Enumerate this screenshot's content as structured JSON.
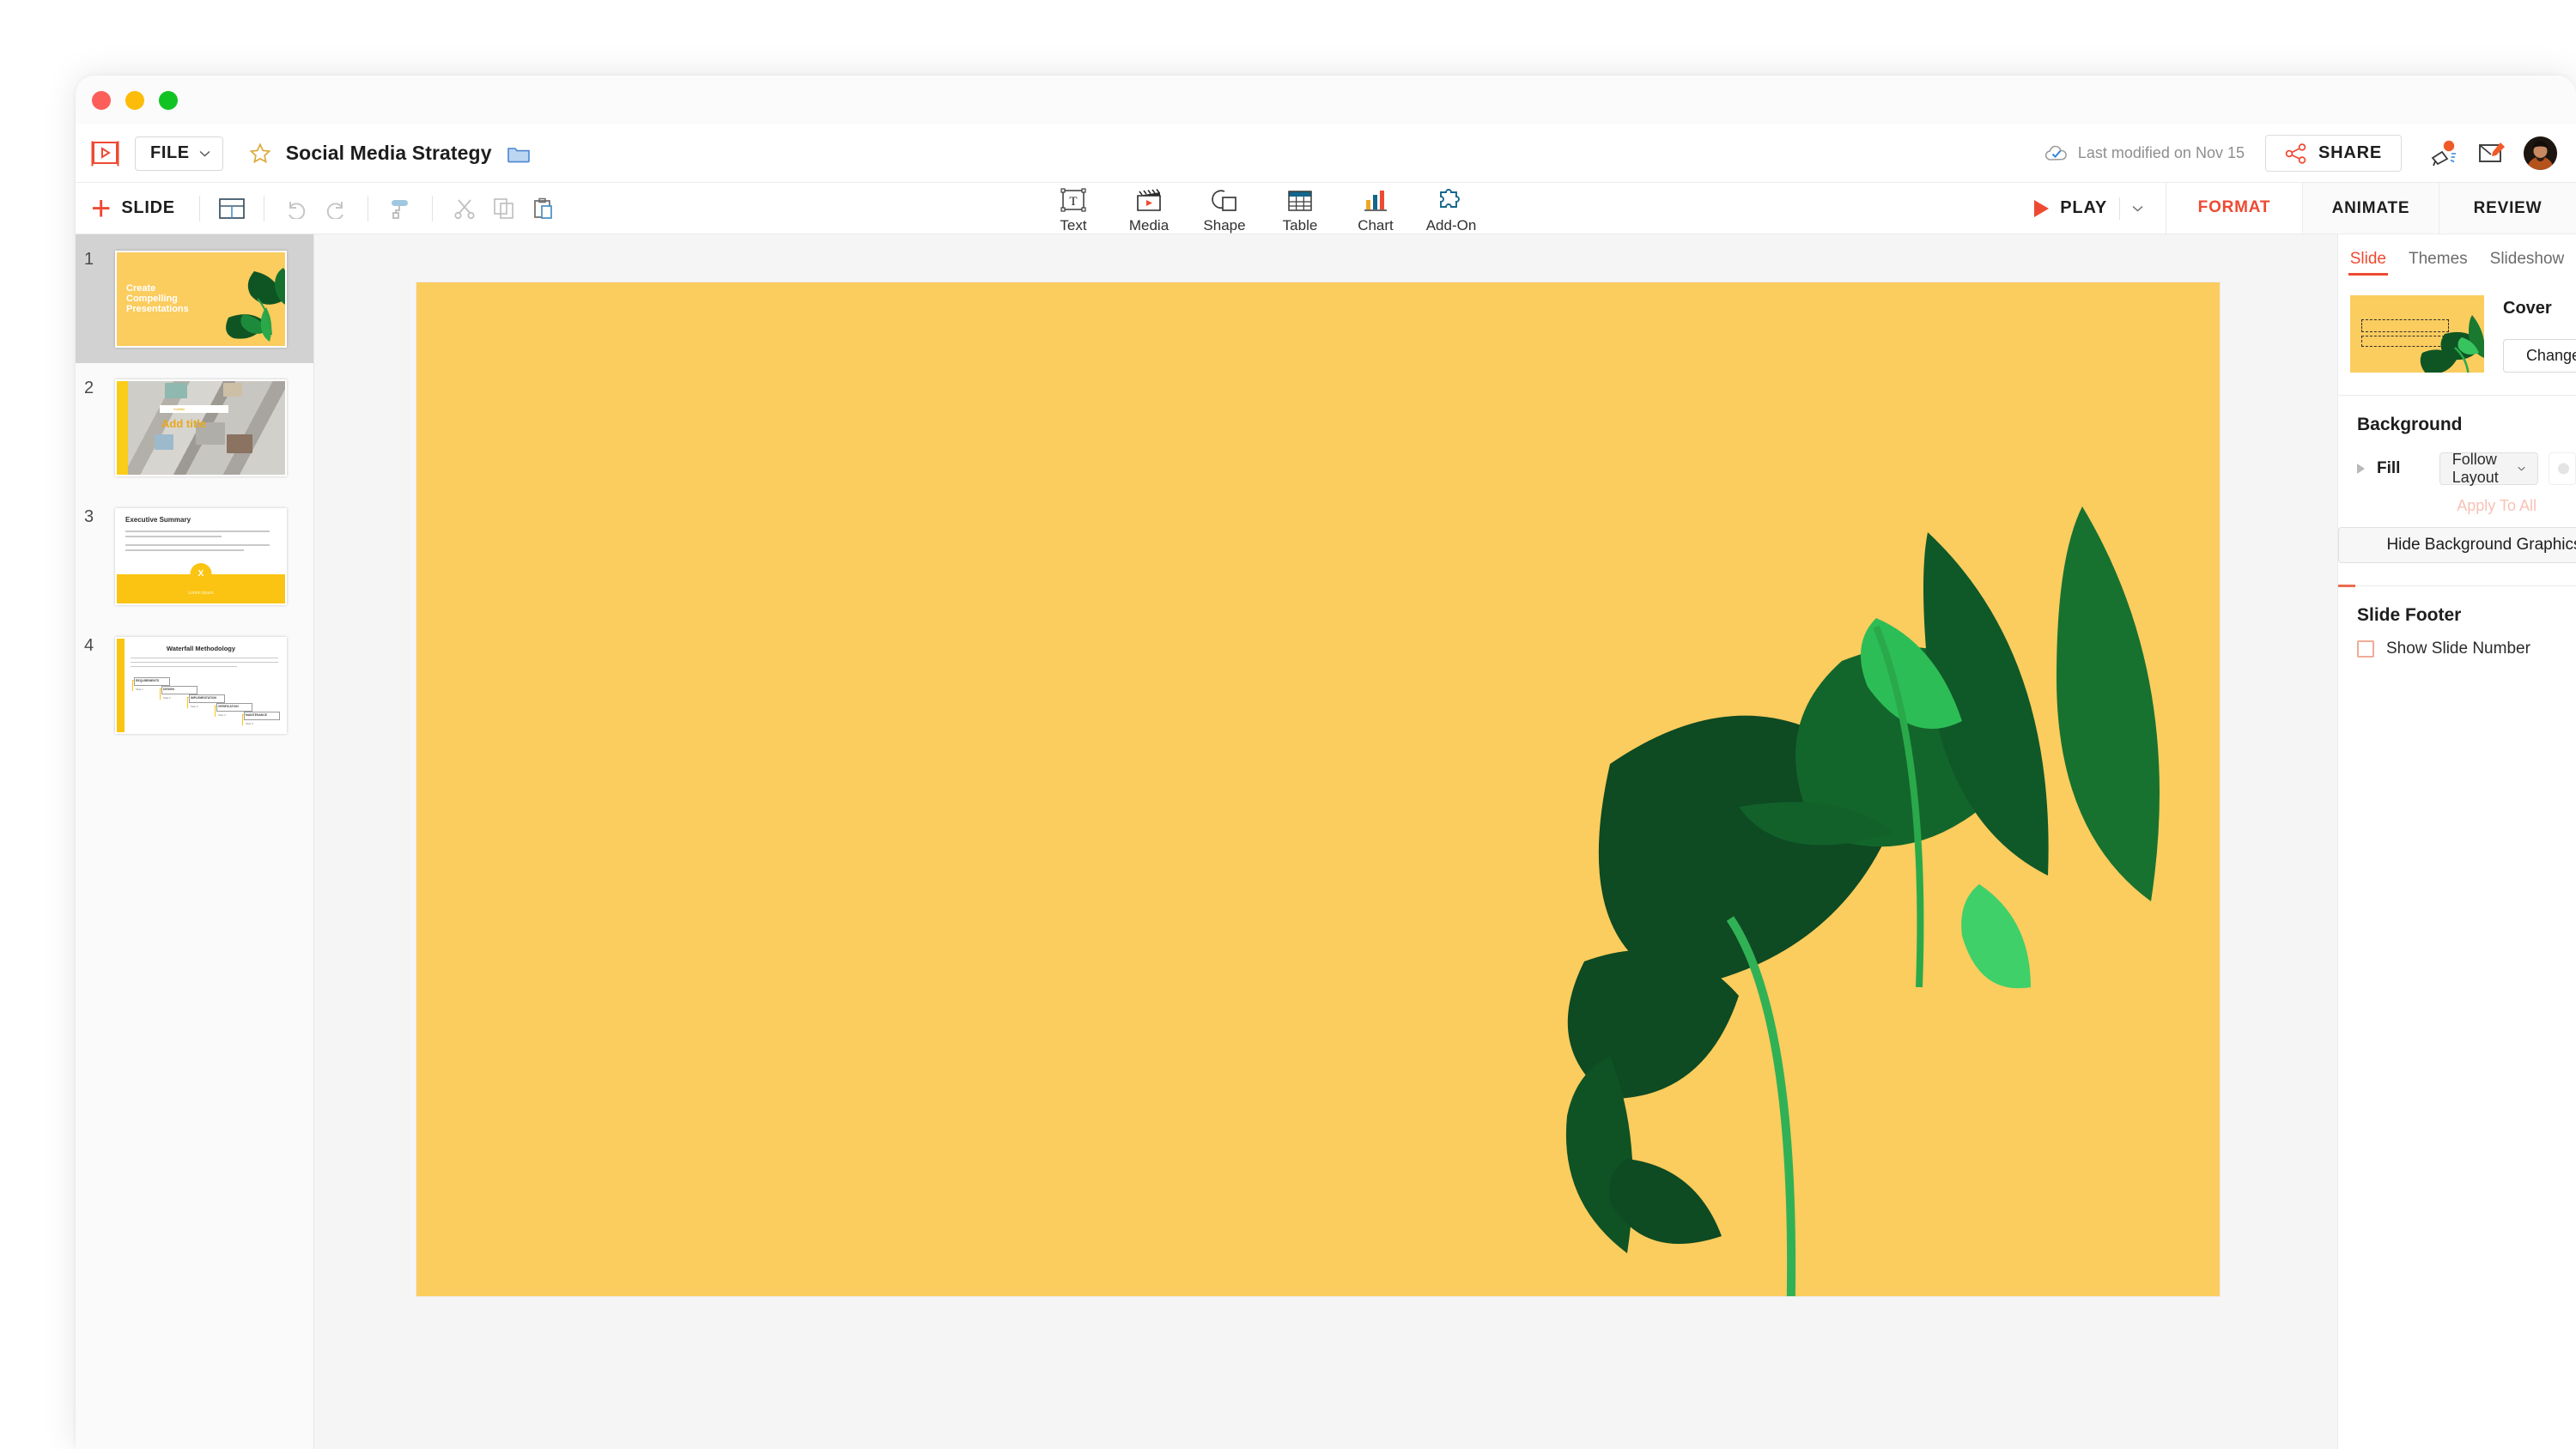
{
  "window": {
    "traffic_lights": [
      "close",
      "minimize",
      "maximize"
    ]
  },
  "header": {
    "logo_icon": "presentation-play-icon",
    "file_menu_label": "FILE",
    "star_icon": "star-favorite-icon",
    "doc_title": "Social Media Strategy",
    "folder_icon": "folder-icon",
    "cloud_icon": "cloud-check-icon",
    "saved_status": "Last modified on Nov 15",
    "share_icon": "share-nodes-icon",
    "share_label": "SHARE",
    "announce_icon": "megaphone-icon",
    "annotate_icon": "screen-pencil-icon",
    "avatar": "user-avatar"
  },
  "toolbar": {
    "add_slide_plus": "+",
    "add_slide_label": "SLIDE",
    "layout_icon": "slide-layout-icon",
    "undo_icon": "undo-icon",
    "redo_icon": "redo-icon",
    "format_painter_icon": "paint-roller-icon",
    "cut_icon": "scissors-icon",
    "copy_icon": "copy-icon",
    "paste_icon": "paste-icon",
    "insert_tools": [
      {
        "label": "Text",
        "icon": "text-box-icon"
      },
      {
        "label": "Media",
        "icon": "clapperboard-media-icon"
      },
      {
        "label": "Shape",
        "icon": "shape-icon"
      },
      {
        "label": "Table",
        "icon": "table-icon"
      },
      {
        "label": "Chart",
        "icon": "bar-chart-icon"
      },
      {
        "label": "Add-On",
        "icon": "puzzle-piece-icon"
      }
    ],
    "play_label": "PLAY",
    "play_caret_icon": "chevron-down-icon"
  },
  "panel_tabs": [
    {
      "label": "FORMAT",
      "active": true
    },
    {
      "label": "ANIMATE",
      "active": false
    },
    {
      "label": "REVIEW",
      "active": false
    }
  ],
  "panel": {
    "subtabs": [
      {
        "label": "Slide",
        "active": true
      },
      {
        "label": "Themes",
        "active": false
      },
      {
        "label": "Slideshow",
        "active": false
      }
    ],
    "cover": {
      "title": "Cover",
      "change_layout_label": "Change Layout",
      "change_layout_caret": "chevron-down-icon"
    },
    "background": {
      "title": "Background",
      "fill_label": "Fill",
      "fill_value": "Follow Layout",
      "fill_caret_icon": "chevron-down-icon",
      "expand_caret_icon": "triangle-right-icon",
      "color_swatch_icon": "color-picker-swatch",
      "apply_to_all_label": "Apply To All",
      "apply_to_all_disabled": true,
      "hide_bg_label": "Hide Background Graphics"
    },
    "slide_footer": {
      "title": "Slide Footer",
      "show_slide_number_label": "Show Slide Number",
      "show_slide_number_checked": false
    }
  },
  "slides": [
    {
      "number": "1",
      "kind": "cover",
      "selected": true,
      "title": "Create Compelling Presentations"
    },
    {
      "number": "2",
      "kind": "photo-title",
      "selected": false,
      "title": "Add title",
      "subtitle": "Subtitle"
    },
    {
      "number": "3",
      "kind": "summary",
      "selected": false,
      "title": "Executive Summary",
      "band_text": "Lorem Ipsum",
      "badge": "X"
    },
    {
      "number": "4",
      "kind": "waterfall",
      "selected": false,
      "title": "Waterfall Methodology",
      "steps": [
        {
          "label": "REQUIREMENTS",
          "sub": "Task 1"
        },
        {
          "label": "DESIGN",
          "sub": "Task 2"
        },
        {
          "label": "IMPLEMENTATION",
          "sub": "Task 3"
        },
        {
          "label": "VERIFICATION",
          "sub": "Task 4"
        },
        {
          "label": "MAINTENANCE",
          "sub": "Task 5"
        }
      ]
    }
  ],
  "canvas": {
    "slide_background": "#fbcc5e",
    "decoration": "monstera-leaves"
  },
  "colors": {
    "accent_red": "#ee4a32",
    "slide_yellow": "#fbcc5e",
    "leaf_dark": "#0e4a22",
    "leaf_mid": "#18792f",
    "leaf_light": "#3fd06a",
    "disabled_pink": "#f6c2b6"
  }
}
